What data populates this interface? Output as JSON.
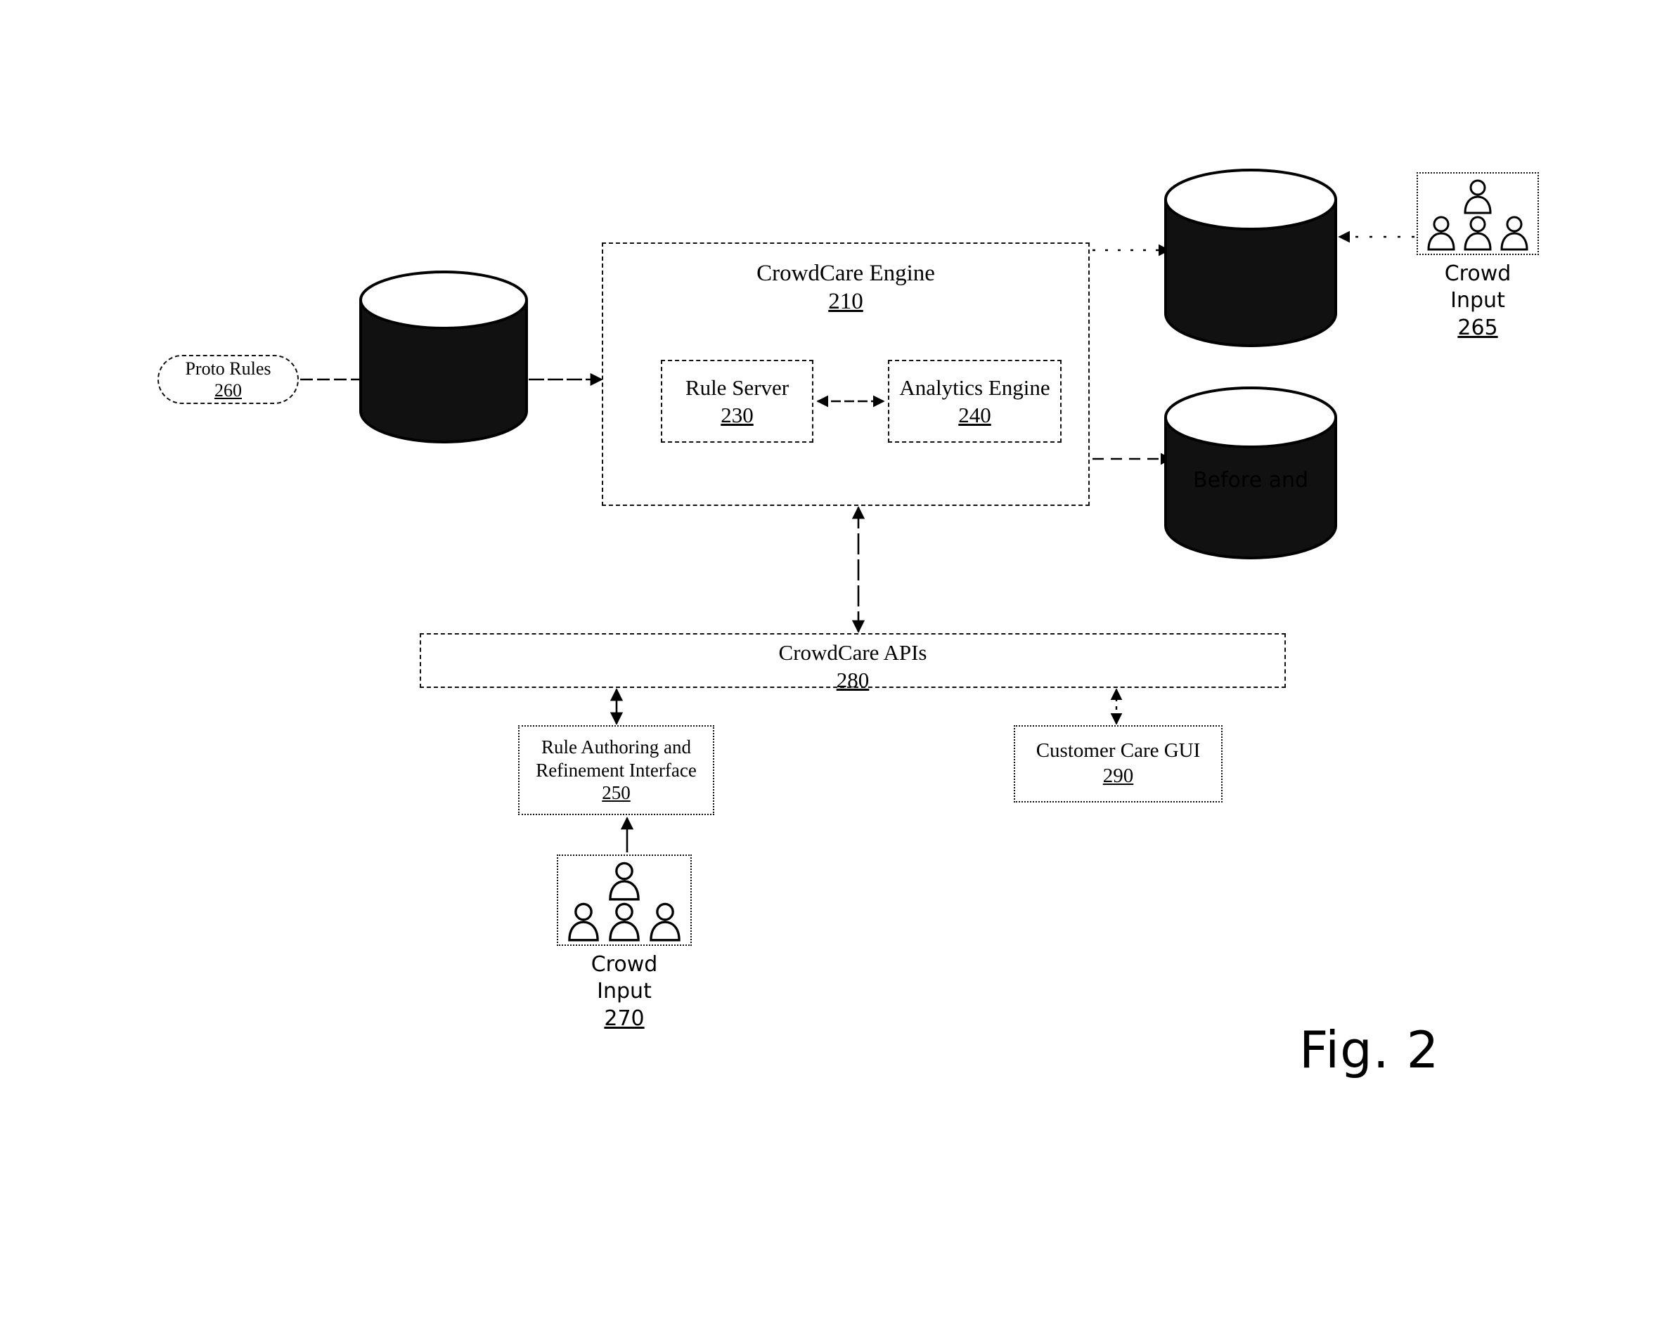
{
  "figure": {
    "label": "Fig. 2",
    "title": "CrowdCare system architecture diagram"
  },
  "nodes": {
    "proto_rules": {
      "label": "Proto Rules",
      "ref": "260",
      "shape": "rounded-pill"
    },
    "proto_rules_store": {
      "label": "",
      "shape": "cylinder"
    },
    "engine": {
      "label": "CrowdCare Engine",
      "ref": "210",
      "shape": "dashed-box"
    },
    "rule_server": {
      "label": "Rule Server",
      "ref": "230",
      "shape": "dashed-box"
    },
    "analytics_engine": {
      "label": "Analytics Engine",
      "ref": "240",
      "shape": "dashed-box"
    },
    "crowd_store": {
      "label": "",
      "shape": "cylinder"
    },
    "before_after_store": {
      "label": "Before and",
      "shape": "cylinder"
    },
    "crowd_input_265": {
      "label_line1": "Crowd",
      "label_line2": "Input",
      "ref": "265",
      "icon": "crowd-people-icon"
    },
    "apis": {
      "label": "CrowdCare APIs",
      "ref": "280",
      "shape": "dashed-bar"
    },
    "authoring": {
      "label_line1": "Rule Authoring and",
      "label_line2": "Refinement Interface",
      "ref": "250",
      "shape": "dashed-box"
    },
    "care_gui": {
      "label": "Customer Care GUI",
      "ref": "290",
      "shape": "dashed-box"
    },
    "crowd_input_270": {
      "label_line1": "Crowd",
      "label_line2": "Input",
      "ref": "270",
      "icon": "crowd-people-icon"
    }
  },
  "colors": {
    "ink": "#000000",
    "paper": "#ffffff",
    "cylinder_fill": "#111111"
  }
}
